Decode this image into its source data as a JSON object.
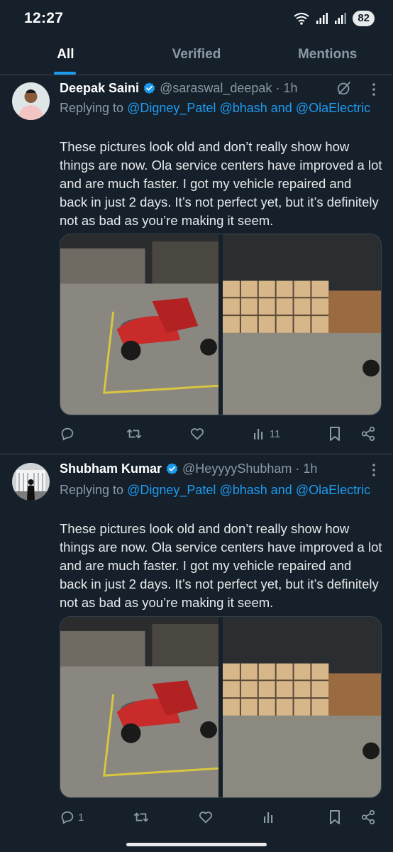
{
  "status_bar": {
    "time": "12:27",
    "battery": "82"
  },
  "tabs": [
    {
      "label": "All",
      "active": true
    },
    {
      "label": "Verified",
      "active": false
    },
    {
      "label": "Mentions",
      "active": false
    }
  ],
  "tweets": [
    {
      "name": "Deepak Saini",
      "handle": "@saraswal_deepak",
      "time": "· 1h",
      "replying_prefix": "Replying to",
      "replying_mentions": [
        "@Digney_Patel",
        "@bhash",
        "and",
        "@OlaElectric"
      ],
      "body": "These pictures look old and don’t really show how things are now. Ola service centers have improved a lot and are much faster. I got my vehicle repaired and back in just 2 days. It’s not perfect yet, but it’s definitely not as bad as you’re making it seem.",
      "reply_count": "",
      "views": "11"
    },
    {
      "name": "Shubham Kumar",
      "handle": "@HeyyyyShubham",
      "time": "· 1h",
      "replying_prefix": "Replying to",
      "replying_mentions": [
        "@Digney_Patel",
        "@bhash",
        "and",
        "@OlaElectric"
      ],
      "body": "These pictures look old and don’t really show how things are now. Ola service centers have improved a lot and are much faster. I got my vehicle repaired and back in just 2 days. It’s not perfect yet, but it’s definitely not as bad as you’re making it seem.",
      "reply_count": "1",
      "views": ""
    }
  ],
  "colors": {
    "background": "#15202b",
    "accent": "#1d9bf0",
    "muted": "#8b98a5",
    "divider": "#38444d"
  },
  "icons": [
    "wifi-icon",
    "signal-icon",
    "verified-badge-icon",
    "grok-icon",
    "more-icon",
    "reply-icon",
    "retweet-icon",
    "like-icon",
    "views-icon",
    "bookmark-icon",
    "share-icon"
  ]
}
